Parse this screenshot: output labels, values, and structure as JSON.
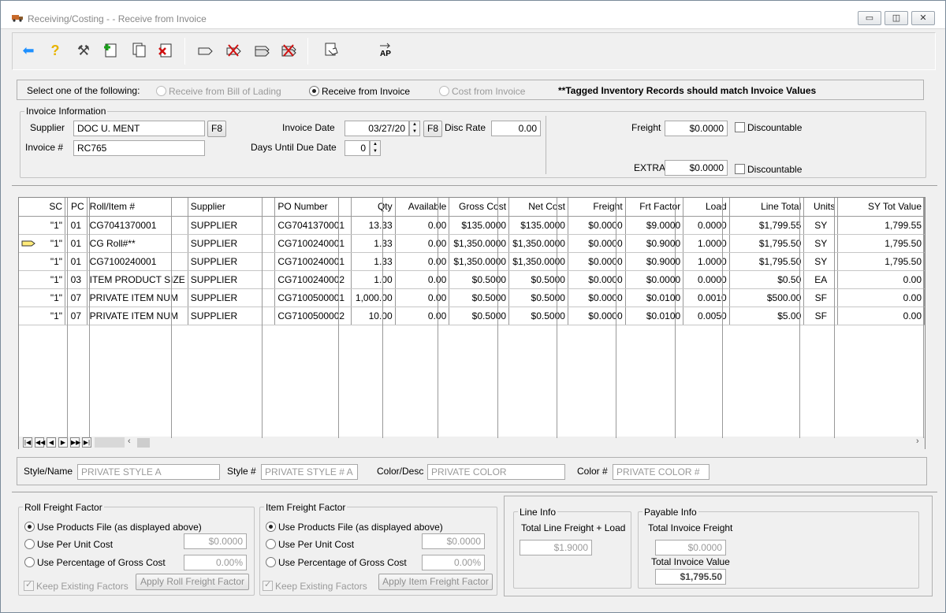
{
  "window": {
    "title": "Receiving/Costing - - Receive from Invoice",
    "controls": [
      "minimize",
      "restore",
      "close"
    ]
  },
  "toolbar": {
    "buttons": [
      "back-arrow-icon",
      "help-icon",
      "tools-icon",
      "new-record-icon",
      "copy-record-icon",
      "delete-record-icon",
      "tag-icon",
      "untag-icon",
      "tag-all-icon",
      "untag-all-icon",
      "hand-point-icon",
      "ap-transfer-icon"
    ]
  },
  "mode": {
    "prompt": "Select one of the following:",
    "opt_bol": "Receive from Bill of Lading",
    "opt_invoice": "Receive from Invoice",
    "opt_cost": "Cost from Invoice",
    "note": "**Tagged Inventory Records should match Invoice Values"
  },
  "invoice": {
    "group_title": "Invoice Information",
    "supplier_label": "Supplier",
    "supplier_value": "DOC U. MENT",
    "f8": "F8",
    "invoice_label": "Invoice #",
    "invoice_value": "RC765",
    "date_label": "Invoice Date",
    "date_value": "03/27/20",
    "days_label": "Days Until Due Date",
    "days_value": "0",
    "disc_label": "Disc Rate",
    "disc_value": "0.00",
    "freight_label": "Freight",
    "freight_value": "$0.0000",
    "discountable": "Discountable",
    "extra_label": "EXTRA",
    "extra_value": "$0.0000"
  },
  "grid": {
    "headers": [
      "SC",
      "PC",
      "Roll/Item #",
      "Supplier",
      "PO Number",
      "Qty",
      "Available",
      "Gross Cost",
      "Net Cost",
      "Freight",
      "Frt Factor",
      "Load",
      "Line Total",
      "Units",
      "SY Tot Value"
    ],
    "rows": [
      {
        "tag": false,
        "cells": [
          "\"1\"",
          "01",
          "CG7041370001",
          "SUPPLIER",
          "CG7041370001",
          "13.33",
          "0.00",
          "$135.0000",
          "$135.0000",
          "$0.0000",
          "$9.0000",
          "0.0000",
          "$1,799.55",
          "SY",
          "1,799.55"
        ]
      },
      {
        "tag": true,
        "cells": [
          "\"1\"",
          "01",
          "CG Roll#**",
          "SUPPLIER",
          "CG7100240001",
          "1.33",
          "0.00",
          "$1,350.0000",
          "$1,350.0000",
          "$0.0000",
          "$0.9000",
          "1.0000",
          "$1,795.50",
          "SY",
          "1,795.50"
        ]
      },
      {
        "tag": false,
        "cells": [
          "\"1\"",
          "01",
          "CG7100240001",
          "SUPPLIER",
          "CG7100240001",
          "1.33",
          "0.00",
          "$1,350.0000",
          "$1,350.0000",
          "$0.0000",
          "$0.9000",
          "1.0000",
          "$1,795.50",
          "SY",
          "1,795.50"
        ]
      },
      {
        "tag": false,
        "cells": [
          "\"1\"",
          "03",
          "ITEM PRODUCT SIZE",
          "SUPPLIER",
          "CG7100240002",
          "1.00",
          "0.00",
          "$0.5000",
          "$0.5000",
          "$0.0000",
          "$0.0000",
          "0.0000",
          "$0.50",
          "EA",
          "0.00"
        ]
      },
      {
        "tag": false,
        "cells": [
          "\"1\"",
          "07",
          "PRIVATE  ITEM NUM",
          "SUPPLIER",
          "CG7100500001",
          "1,000.00",
          "0.00",
          "$0.5000",
          "$0.5000",
          "$0.0000",
          "$0.0100",
          "0.0010",
          "$500.00",
          "SF",
          "0.00"
        ]
      },
      {
        "tag": false,
        "cells": [
          "\"1\"",
          "07",
          "PRIVATE  ITEM NUM",
          "SUPPLIER",
          "CG7100500002",
          "10.00",
          "0.00",
          "$0.5000",
          "$0.5000",
          "$0.0000",
          "$0.0100",
          "0.0050",
          "$5.00",
          "SF",
          "0.00"
        ]
      }
    ]
  },
  "style": {
    "style_label": "Style/Name",
    "style_value": "PRIVATE  STYLE A",
    "num_label": "Style #",
    "num_value": "PRIVATE STYLE # A",
    "color_label": "Color/Desc",
    "color_value": "PRIVATE  COLOR",
    "colornum_label": "Color #",
    "colornum_value": "PRIVATE COLOR #"
  },
  "roll_freight": {
    "title": "Roll Freight Factor",
    "opt1": "Use Products File (as displayed above)",
    "opt2": "Use Per Unit Cost",
    "opt2_value": "$0.0000",
    "opt3": "Use Percentage of Gross Cost",
    "opt3_value": "0.00%",
    "keep": "Keep Existing Factors",
    "apply": "Apply Roll Freight Factor"
  },
  "item_freight": {
    "title": "Item Freight Factor",
    "opt1": "Use Products File (as displayed above)",
    "opt2": "Use Per Unit Cost",
    "opt2_value": "$0.0000",
    "opt3": "Use Percentage of Gross Cost",
    "opt3_value": "0.00%",
    "keep": "Keep Existing Factors",
    "apply": "Apply Item Freight Factor"
  },
  "line_info": {
    "title": "Line Info",
    "label": "Total Line Freight + Load",
    "value": "$1.9000"
  },
  "payable_info": {
    "title": "Payable Info",
    "freight_label": "Total Invoice Freight",
    "freight_value": "$0.0000",
    "value_label": "Total Invoice Value",
    "value_value": "$1,795.50"
  }
}
